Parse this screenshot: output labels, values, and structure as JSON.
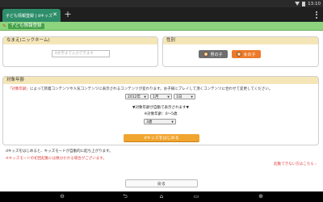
{
  "status_bar": {
    "time": "13:10"
  },
  "browser": {
    "tab_title": "子ども情報登録 | dキッズ",
    "tab_close": "✕",
    "new_tab": "+"
  },
  "page_header": {
    "label": "子ども情報登録"
  },
  "name_section": {
    "title": "なまえ(ニックネーム)",
    "placeholder": "8文字まで入力できます",
    "value": ""
  },
  "gender_section": {
    "title": "性別",
    "boy_label": "男の子",
    "girl_label": "女の子",
    "selected": "girl"
  },
  "age_section": {
    "title": "対象年齢",
    "description_key": "「対象年齢」",
    "description_rest": "によって新着コンテンツや人気コンテンツに表示されるコンテンツが変わります。お子様にプレイして頂くコンテンツに合わせて変更してください。",
    "year": "2012年",
    "month": "1月",
    "day": "1日",
    "auto_note": "▼対象年齢が自動で表示されます▼",
    "range_label": "※対象年齢：0～5歳",
    "grade": "3歳"
  },
  "actions": {
    "start_label": "dキッズをはじめる",
    "back_label": "戻る",
    "help_link": "起動できない方はこちら"
  },
  "notes": {
    "info": "dキッズをはじめると、キッズモードが自動的に起ち上がります。",
    "warning": "※キッズモードの初回起動には数分かかる場合がございます。"
  },
  "colors": {
    "header_green": "#8dd47f",
    "tab_green": "#2e8e6a",
    "panel_head": "#f5e6b8",
    "accent_orange": "#f0a52e",
    "girl_orange": "#ed7a2b",
    "warning_red": "#e04444"
  },
  "icons": {
    "page_header": "pencil-icon",
    "nav_back": "back-arrow-icon",
    "nav_home": "home-icon",
    "nav_recent": "recent-apps-icon"
  }
}
